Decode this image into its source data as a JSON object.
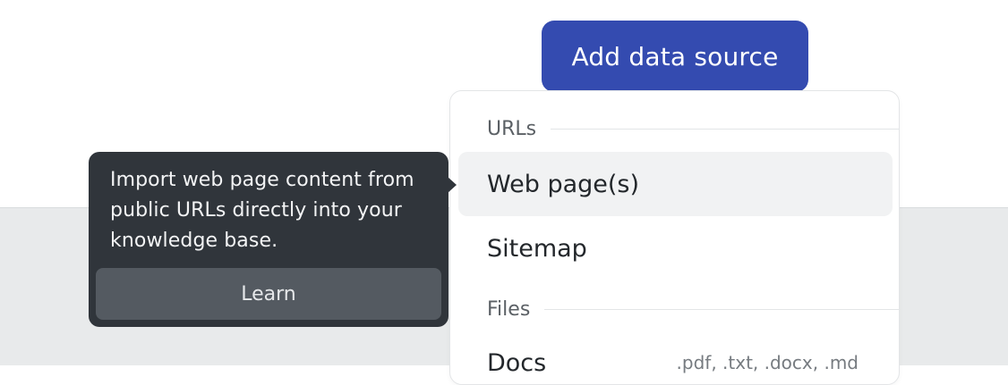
{
  "header": {
    "add_button_label": "Add data source"
  },
  "menu": {
    "sections": [
      {
        "label": "URLs"
      },
      {
        "label": "Files"
      }
    ],
    "items": [
      {
        "label": "Web page(s)",
        "hovered": true
      },
      {
        "label": "Sitemap"
      },
      {
        "label": "Docs",
        "extensions": ".pdf, .txt, .docx, .md"
      }
    ]
  },
  "tooltip": {
    "text": "Import web page content from public URLs directly into your knowledge base.",
    "learn_label": "Learn"
  },
  "colors": {
    "accent": "#344bb0",
    "tooltip_bg": "#30353b",
    "hover_bg": "#f1f2f3",
    "page_bottom_bg": "#e8eaeb"
  }
}
